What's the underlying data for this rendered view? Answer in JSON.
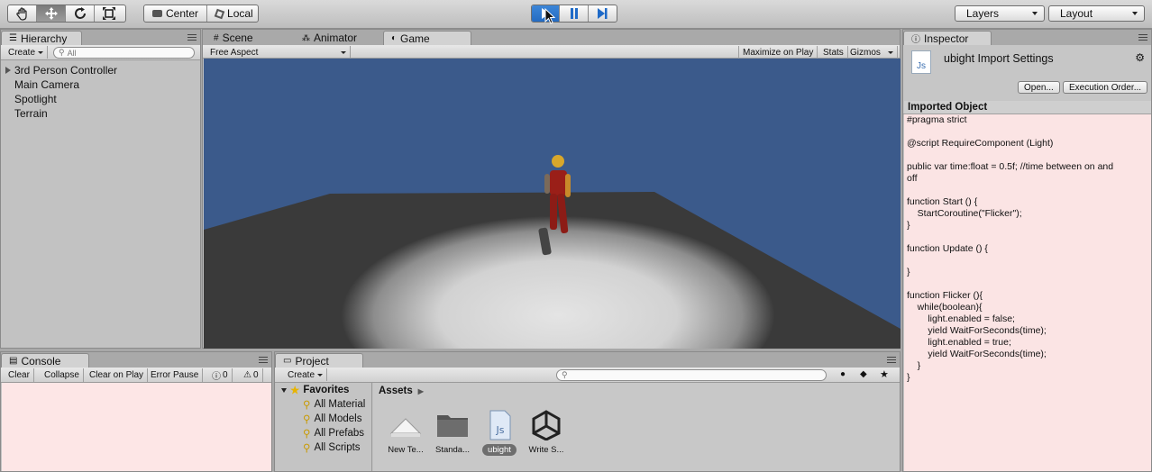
{
  "toolbar": {
    "transform_tools": [
      "hand-icon",
      "move-icon",
      "rotate-icon",
      "scale-icon"
    ],
    "pivot_center": "Center",
    "pivot_local": "Local",
    "playback": [
      "play-icon",
      "pause-icon",
      "step-icon"
    ],
    "layers_label": "Layers",
    "layout_label": "Layout"
  },
  "hierarchy": {
    "tab": "Hierarchy",
    "create_label": "Create",
    "search_placeholder": "All",
    "items": [
      "3rd Person Controller",
      "Main Camera",
      "Spotlight",
      "Terrain"
    ]
  },
  "tabs": {
    "scene": "Scene",
    "animator": "Animator",
    "game": "Game"
  },
  "game": {
    "aspect": "Free Aspect",
    "maximize": "Maximize on Play",
    "stats": "Stats",
    "gizmos": "Gizmos"
  },
  "inspector": {
    "tab": "Inspector",
    "title": "ubight Import Settings",
    "open_button": "Open...",
    "exec_button": "Execution Order...",
    "section": "Imported Object",
    "code": [
      "#pragma strict",
      "",
      "@script RequireComponent (Light)",
      "",
      "public var time:float = 0.5f; //time between on and",
      "off",
      "",
      "function Start () {",
      "    StartCoroutine(\"Flicker\");",
      "}",
      "",
      "function Update () {",
      "",
      "}",
      "",
      "function Flicker (){",
      "    while(boolean){",
      "        light.enabled = false;",
      "        yield WaitForSeconds(time);",
      "        light.enabled = true;",
      "        yield WaitForSeconds(time);",
      "    }",
      "}"
    ]
  },
  "console": {
    "tab": "Console",
    "clear": "Clear",
    "collapse": "Collapse",
    "clear_on_play": "Clear on Play",
    "error_pause": "Error Pause",
    "info_count": "0",
    "warn_count": "0"
  },
  "project": {
    "tab": "Project",
    "create_label": "Create",
    "favorites_label": "Favorites",
    "favorites": [
      "All Material",
      "All Models",
      "All Prefabs",
      "All Scripts"
    ],
    "breadcrumb": "Assets",
    "assets": [
      {
        "label": "New Te...",
        "icon": "terrain-icon"
      },
      {
        "label": "Standa...",
        "icon": "folder-icon"
      },
      {
        "label": "ubight",
        "icon": "js-script-icon"
      },
      {
        "label": "Write S...",
        "icon": "unity-logo-icon"
      }
    ]
  },
  "colors": {
    "sky": "#3b5a8b",
    "selection": "#2b6bcc",
    "code_bg": "#fbe4e4"
  }
}
